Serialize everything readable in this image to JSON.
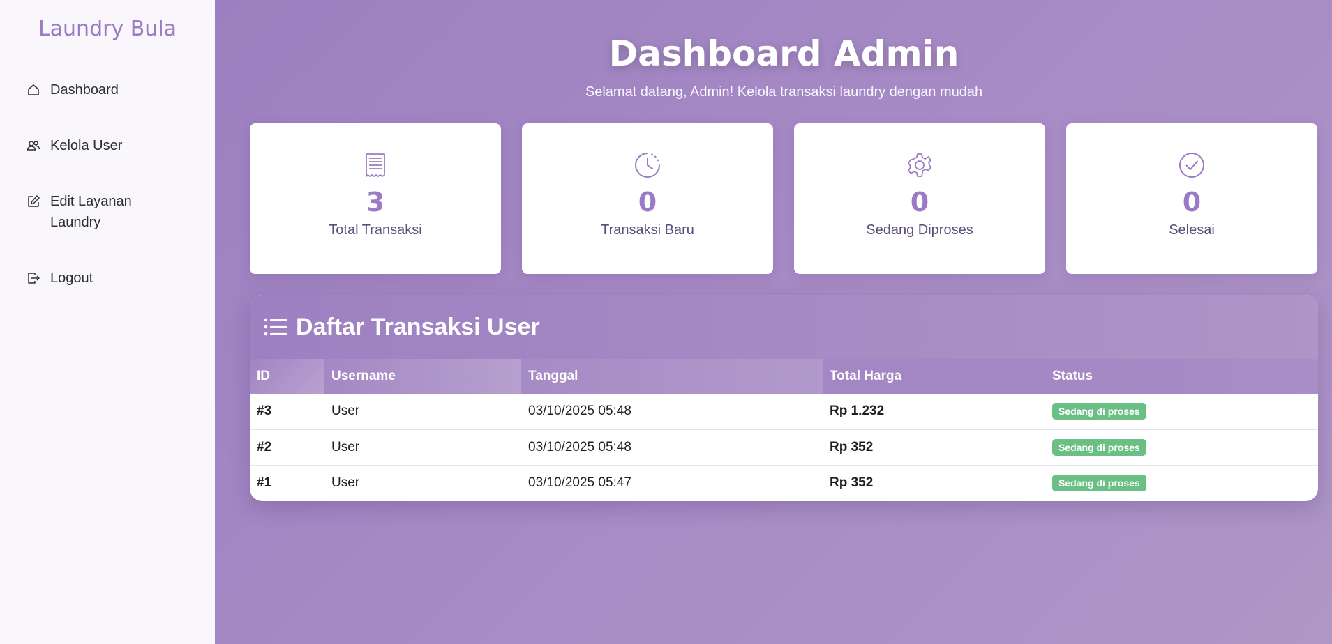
{
  "sidebar": {
    "brand": "Laundry Bula",
    "items": [
      {
        "label": "Dashboard",
        "icon": "home-icon"
      },
      {
        "label": "Kelola User",
        "icon": "users-icon"
      },
      {
        "label": "Edit Layanan Laundry",
        "icon": "edit-icon"
      },
      {
        "label": "Logout",
        "icon": "logout-icon"
      }
    ]
  },
  "header": {
    "title": "Dashboard Admin",
    "subtitle": "Selamat datang, Admin! Kelola transaksi laundry dengan mudah"
  },
  "stats": [
    {
      "value": "3",
      "label": "Total Transaksi",
      "icon": "receipt-icon"
    },
    {
      "value": "0",
      "label": "Transaksi Baru",
      "icon": "clock-icon"
    },
    {
      "value": "0",
      "label": "Sedang Diproses",
      "icon": "gear-icon"
    },
    {
      "value": "0",
      "label": "Selesai",
      "icon": "check-circle-icon"
    }
  ],
  "transactions": {
    "title": "Daftar Transaksi User",
    "icon": "list-icon",
    "columns": [
      "ID",
      "Username",
      "Tanggal",
      "Total Harga",
      "Status"
    ],
    "rows": [
      {
        "id": "#3",
        "username": "User",
        "date": "03/10/2025 05:48",
        "total": "Rp 1.232",
        "status": "Sedang di proses"
      },
      {
        "id": "#2",
        "username": "User",
        "date": "03/10/2025 05:48",
        "total": "Rp 352",
        "status": "Sedang di proses"
      },
      {
        "id": "#1",
        "username": "User",
        "date": "03/10/2025 05:47",
        "total": "Rp 352",
        "status": "Sedang di proses"
      }
    ]
  },
  "colors": {
    "accent": "#9b7bc3",
    "background": "#a88cc4",
    "status_badge": "#6abf85"
  }
}
